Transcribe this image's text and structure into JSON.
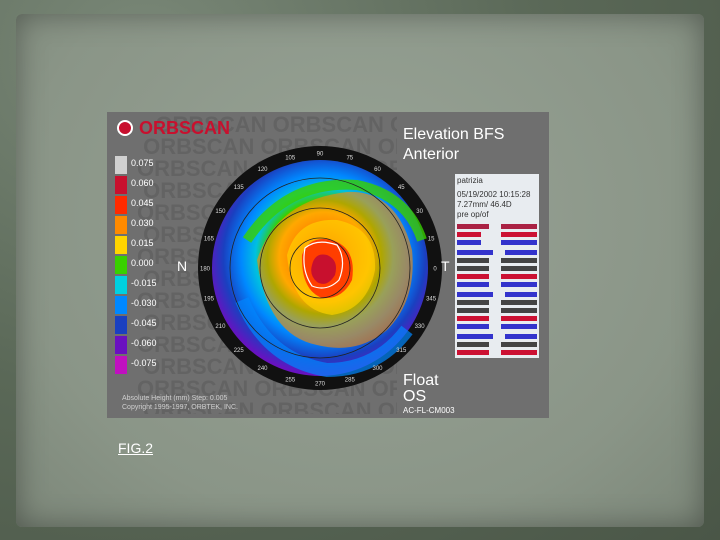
{
  "figure": {
    "logo": "ORBSCAN",
    "title_line1": "Elevation BFS",
    "title_line2": "Anterior",
    "left_label": "N",
    "right_label": "T",
    "bottom_line1": "Float",
    "bottom_line2": "OS",
    "bottom_code": "AC-FL-CM003",
    "footer_line1": "Absolute Height (mm) Step: 0.005",
    "footer_line2": "Copyright 1995-1997, ORBTEK, INC.",
    "scale": [
      "0.075",
      "0.060",
      "0.045",
      "0.030",
      "0.015",
      "0.000",
      "-0.015",
      "-0.030",
      "-0.045",
      "-0.060",
      "-0.075"
    ],
    "scale_colors": [
      "#d0d0d0",
      "#c8102e",
      "#ff2a00",
      "#ff8a00",
      "#ffd400",
      "#38d000",
      "#00d0e0",
      "#0088ff",
      "#1a40c0",
      "#6a10c0",
      "#c010c0"
    ],
    "degree_labels": [
      "120",
      "105",
      "90",
      "75",
      "60",
      "135",
      "150",
      "165",
      "180",
      "195",
      "210",
      "225",
      "240",
      "255",
      "270",
      "285",
      "300",
      "315",
      "330",
      "345",
      "0",
      "15",
      "30",
      "45"
    ],
    "info": {
      "name": "patrizia",
      "date": "05/19/2002 10:15:28",
      "radius": "7.27mm/ 46.4D",
      "pre": "pre op/of"
    }
  },
  "fig_label": "FIG.2"
}
